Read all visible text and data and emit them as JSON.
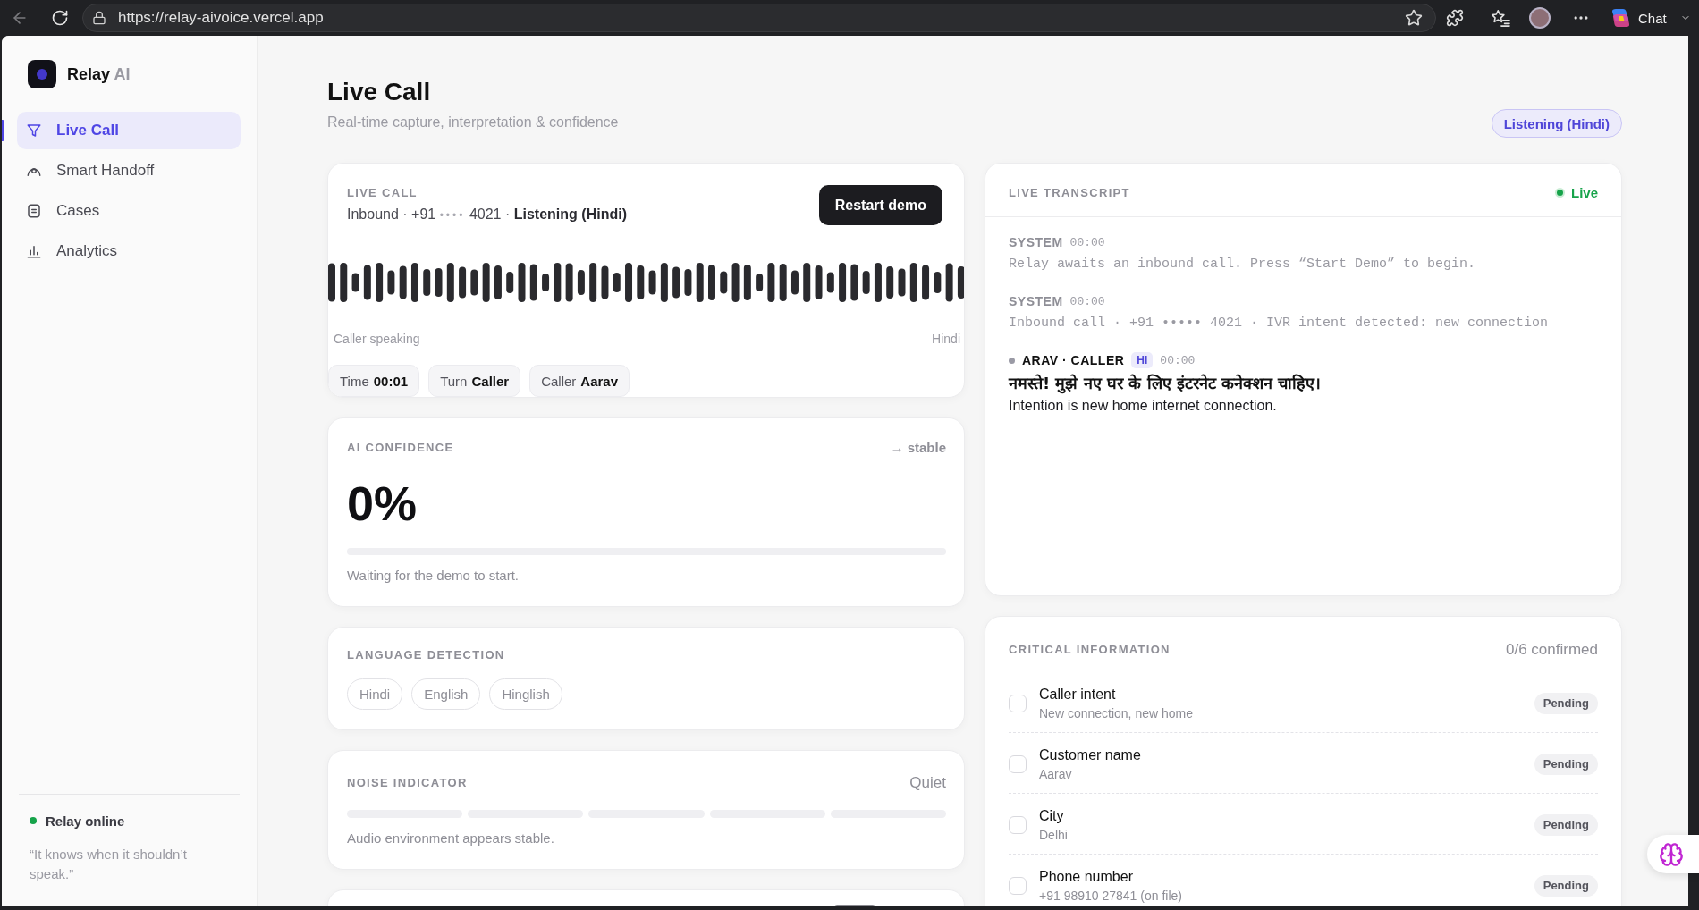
{
  "browser": {
    "url": "https://relay-aivoice.vercel.app",
    "chat_label": "Chat"
  },
  "sidebar": {
    "brand": {
      "name": "Relay",
      "suffix": "AI"
    },
    "items": [
      {
        "label": "Live Call",
        "selected": true
      },
      {
        "label": "Smart Handoff",
        "selected": false
      },
      {
        "label": "Cases",
        "selected": false
      },
      {
        "label": "Analytics",
        "selected": false
      }
    ],
    "status": {
      "label": "Relay online",
      "online": true
    },
    "quote": "“It knows when it shouldn’t speak.”"
  },
  "header": {
    "title": "Live Call",
    "subtitle": "Real-time capture, interpretation & confidence",
    "badge": "Listening (Hindi)"
  },
  "live_call": {
    "label": "LIVE CALL",
    "info_parts": [
      {
        "kind": "plain",
        "text": "Inbound · +91"
      },
      {
        "kind": "masked",
        "text": "••••"
      },
      {
        "kind": "plain",
        "text": "4021 ·"
      },
      {
        "kind": "strong",
        "text": "Listening (Hindi)"
      }
    ],
    "button": "Restart demo",
    "left_caption": "Caller speaking",
    "right_caption": "Hindi",
    "chips": [
      {
        "label": "Time",
        "value": "00:01"
      },
      {
        "label": "Turn",
        "value": "Caller"
      },
      {
        "label": "Caller",
        "value": "Aarav"
      }
    ]
  },
  "confidence": {
    "label": "AI CONFIDENCE",
    "trend": "→ stable",
    "value": "0%",
    "level": 0,
    "note": "Waiting for the demo to start."
  },
  "language": {
    "label": "LANGUAGE DETECTION",
    "options": [
      {
        "label": "Hindi",
        "detected": false
      },
      {
        "label": "English",
        "detected": false
      },
      {
        "label": "Hinglish",
        "detected": false
      }
    ]
  },
  "noise": {
    "label": "NOISE INDICATOR",
    "reading": "Quiet",
    "level": 0,
    "note": "Audio environment appears stable."
  },
  "transcript": {
    "label": "LIVE TRANSCRIPT",
    "live_label": "Live",
    "live": true,
    "entries": [
      {
        "kind": "system",
        "speaker": "SYSTEM",
        "time": "00:00",
        "text": "Relay awaits an inbound call. Press “Start Demo” to begin."
      },
      {
        "kind": "system",
        "speaker": "SYSTEM",
        "time": "00:00",
        "text": "Inbound call · +91 ••••• 4021 · IVR intent detected: new connection"
      },
      {
        "kind": "caller",
        "speaker": "ARAV · CALLER",
        "language": "HI",
        "time": "00:00",
        "text": "नमस्ते! मुझे नए घर के लिए इंटरनेट कनेक्शन चाहिए।",
        "translation": "Intention is new home internet connection."
      }
    ]
  },
  "critical": {
    "label": "CRITICAL INFORMATION",
    "count": "0/6 confirmed",
    "items": [
      {
        "title": "Caller intent",
        "detail": "New connection, new home",
        "checked": false,
        "status": "Pending"
      },
      {
        "title": "Customer name",
        "detail": "Aarav",
        "checked": false,
        "status": "Pending"
      },
      {
        "title": "City",
        "detail": "Delhi",
        "checked": false,
        "status": "Pending"
      },
      {
        "title": "Phone number",
        "detail": "+91 98910 27841 (on file)",
        "checked": false,
        "status": "Pending"
      }
    ]
  }
}
